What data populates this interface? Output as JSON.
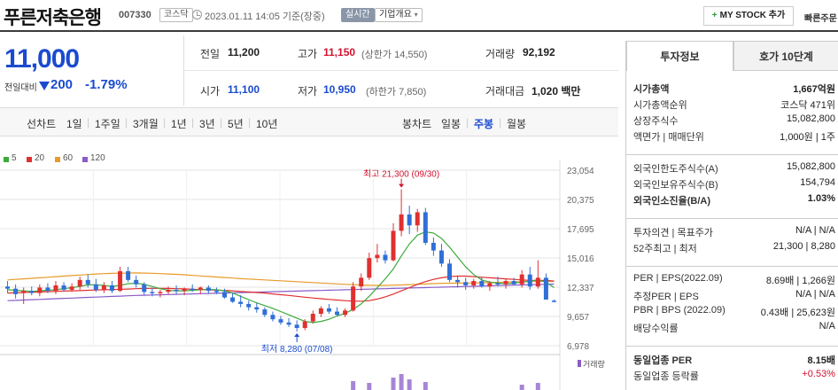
{
  "header": {
    "company_name": "푸른저축은행",
    "code": "007330",
    "market_badge": "코스닥",
    "datetime": "2023.01.11 14:05 기준(장중)",
    "realtime_badge": "실시간",
    "corp_overview": "기업개요",
    "my_stock_button": "MY STOCK 추가",
    "quick_link": "빠른주문"
  },
  "price": {
    "current": "11,000",
    "change_label": "전일대비",
    "change_value": "200",
    "change_pct": "-1.79%"
  },
  "summary": {
    "prev_close_label": "전일",
    "prev_close": "11,200",
    "high_label": "고가",
    "high": "11,150",
    "upper_limit": "(상한가 14,550)",
    "volume_label": "거래량",
    "volume": "92,192",
    "open_label": "시가",
    "open": "11,100",
    "low_label": "저가",
    "low": "10,950",
    "lower_limit": "(하한가 7,850)",
    "amount_label": "거래대금",
    "amount": "1,020 백만"
  },
  "period_bar": {
    "line_chart_label": "선차트",
    "line_periods": [
      "1일",
      "1주일",
      "3개월",
      "1년",
      "3년",
      "5년",
      "10년"
    ],
    "candle_label": "봉차트",
    "candle_periods": [
      "일봉",
      "주봉",
      "월봉"
    ],
    "active_candle": "주봉"
  },
  "chart": {
    "legend": [
      {
        "label": "5",
        "color": "#3caa3c"
      },
      {
        "label": "20",
        "color": "#e03030"
      },
      {
        "label": "60",
        "color": "#e89a2a"
      },
      {
        "label": "120",
        "color": "#8a5cc8"
      }
    ],
    "high_annotation": "최고 21,300 (09/30)",
    "low_annotation": "최저 8,280 (07/08)",
    "y_ticks": [
      "23,054",
      "20,375",
      "17,695",
      "15,016",
      "12,337",
      "9,657",
      "6,978"
    ],
    "volume_label": "거래량",
    "up_color": "#e03030",
    "down_color": "#2f6fd6"
  },
  "chart_data": {
    "type": "candlestick",
    "ylim": [
      6978,
      23054
    ],
    "y_ticks": [
      23054,
      20375,
      17695,
      15016,
      12337,
      9657,
      6978
    ],
    "candles": [
      [
        12400,
        12900,
        11800,
        12200
      ],
      [
        12200,
        12600,
        11300,
        11700
      ],
      [
        11800,
        12300,
        10800,
        12000
      ],
      [
        12000,
        12400,
        11600,
        11800
      ],
      [
        11800,
        12600,
        11500,
        12300
      ],
      [
        12300,
        12700,
        11800,
        12000
      ],
      [
        12000,
        12900,
        11700,
        12500
      ],
      [
        12500,
        12800,
        12000,
        12100
      ],
      [
        12100,
        12700,
        11900,
        12400
      ],
      [
        12400,
        13300,
        12100,
        13000
      ],
      [
        13000,
        13500,
        12300,
        12600
      ],
      [
        12600,
        13100,
        11900,
        12100
      ],
      [
        12100,
        12800,
        11800,
        12500
      ],
      [
        12500,
        12900,
        11800,
        12000
      ],
      [
        12000,
        14200,
        11900,
        13800
      ],
      [
        13800,
        14200,
        12800,
        13000
      ],
      [
        13000,
        13400,
        12300,
        12600
      ],
      [
        12600,
        12800,
        11600,
        11900
      ],
      [
        11900,
        12300,
        11500,
        11800
      ],
      [
        11800,
        12100,
        11400,
        11900
      ],
      [
        11900,
        12400,
        11700,
        12100
      ],
      [
        12100,
        12500,
        11700,
        12000
      ],
      [
        12000,
        12300,
        11600,
        12200
      ],
      [
        12200,
        12600,
        11900,
        12100
      ],
      [
        12100,
        12400,
        11700,
        12300
      ],
      [
        12300,
        12500,
        11800,
        12000
      ],
      [
        12000,
        12300,
        11700,
        11900
      ],
      [
        11900,
        12200,
        11300,
        11400
      ],
      [
        11400,
        11800,
        10900,
        11000
      ],
      [
        11000,
        11600,
        10500,
        10800
      ],
      [
        10800,
        11100,
        10200,
        10500
      ],
      [
        10500,
        10900,
        10000,
        10300
      ],
      [
        10300,
        10500,
        9600,
        9800
      ],
      [
        9800,
        10100,
        9200,
        9400
      ],
      [
        9400,
        9700,
        8900,
        9100
      ],
      [
        9100,
        9500,
        8700,
        8900
      ],
      [
        8900,
        9300,
        8280,
        8600
      ],
      [
        8600,
        9400,
        8400,
        9200
      ],
      [
        9200,
        10200,
        9000,
        9900
      ],
      [
        9900,
        10600,
        9600,
        10400
      ],
      [
        10400,
        10800,
        9900,
        10100
      ],
      [
        10100,
        10500,
        9700,
        9800
      ],
      [
        9800,
        10400,
        9600,
        10200
      ],
      [
        10200,
        12800,
        10100,
        12400
      ],
      [
        12400,
        13600,
        12000,
        13200
      ],
      [
        13200,
        15500,
        13000,
        15000
      ],
      [
        15000,
        16300,
        14600,
        15300
      ],
      [
        15300,
        15700,
        14500,
        14800
      ],
      [
        14800,
        18200,
        14700,
        17500
      ],
      [
        17500,
        21300,
        17000,
        19000
      ],
      [
        19000,
        19800,
        17200,
        18000
      ],
      [
        18000,
        19500,
        17400,
        19200
      ],
      [
        19200,
        19600,
        16200,
        16400
      ],
      [
        16400,
        16900,
        15200,
        15700
      ],
      [
        15700,
        16300,
        14200,
        14500
      ],
      [
        14500,
        14900,
        12800,
        13000
      ],
      [
        13000,
        13400,
        12300,
        12800
      ],
      [
        12800,
        13200,
        12100,
        12500
      ],
      [
        12500,
        13100,
        12200,
        12900
      ],
      [
        12900,
        13300,
        12300,
        12400
      ],
      [
        12400,
        12900,
        12000,
        12700
      ],
      [
        12700,
        13300,
        12400,
        12600
      ],
      [
        12600,
        13100,
        12200,
        12900
      ],
      [
        12900,
        13200,
        12500,
        12600
      ],
      [
        12600,
        13900,
        12300,
        13500
      ],
      [
        13500,
        14200,
        12100,
        12400
      ],
      [
        12400,
        14800,
        12200,
        13200
      ],
      [
        13200,
        13600,
        11400,
        11200
      ],
      [
        11100,
        11200,
        10950,
        11000
      ]
    ],
    "ma5": [
      12100,
      12050,
      12000,
      11950,
      12000,
      12050,
      12100,
      12200,
      12300,
      12400,
      12550,
      12550,
      12500,
      12400,
      12500,
      12650,
      12700,
      12600,
      12400,
      12200,
      12050,
      12000,
      12000,
      12050,
      12100,
      12150,
      12100,
      12000,
      11800,
      11500,
      11200,
      10900,
      10650,
      10400,
      10100,
      9800,
      9500,
      9200,
      9100,
      9200,
      9400,
      9700,
      9950,
      10300,
      10800,
      11500,
      12300,
      13100,
      14000,
      15200,
      16300,
      17100,
      17400,
      17300,
      16800,
      16000,
      15100,
      14200,
      13500,
      13000,
      12800,
      12700,
      12650,
      12700,
      12800,
      12900,
      13000,
      12800,
      12300
    ],
    "ma20": [
      11800,
      11820,
      11850,
      11870,
      11900,
      11920,
      11950,
      11980,
      12000,
      12020,
      12050,
      12080,
      12100,
      12120,
      12150,
      12170,
      12200,
      12220,
      12230,
      12230,
      12220,
      12200,
      12180,
      12150,
      12120,
      12100,
      12070,
      12040,
      12000,
      11950,
      11900,
      11850,
      11800,
      11720,
      11650,
      11580,
      11500,
      11420,
      11350,
      11280,
      11220,
      11160,
      11100,
      11050,
      11050,
      11100,
      11250,
      11450,
      11700,
      12000,
      12300,
      12600,
      12850,
      13050,
      13200,
      13300,
      13350,
      13350,
      13300,
      13250,
      13200,
      13150,
      13100,
      13050,
      13000,
      12950,
      12950,
      12950,
      12900
    ],
    "ma60": [
      13000,
      13050,
      13100,
      13150,
      13200,
      13250,
      13300,
      13350,
      13400,
      13450,
      13500,
      13550,
      13580,
      13600,
      13620,
      13630,
      13640,
      13630,
      13610,
      13580,
      13550,
      13510,
      13470,
      13420,
      13370,
      13320,
      13270,
      13220,
      13170,
      13120,
      13080,
      13040,
      13000,
      12960,
      12920,
      12880,
      12840,
      12800,
      12760,
      12720,
      12680,
      12640,
      12600,
      12560,
      12530,
      12510,
      12500,
      12500,
      12520,
      12540,
      12570,
      12600,
      12630,
      12660,
      12690,
      12700,
      12710,
      12720,
      12730,
      12740,
      12760,
      12780,
      12800,
      12820,
      12840,
      12860,
      12870,
      12870,
      12870
    ],
    "ma120": [
      11100,
      11130,
      11160,
      11190,
      11220,
      11250,
      11280,
      11310,
      11340,
      11370,
      11400,
      11430,
      11460,
      11490,
      11520,
      11550,
      11580,
      11600,
      11620,
      11640,
      11660,
      11680,
      11700,
      11720,
      11740,
      11760,
      11780,
      11800,
      11820,
      11840,
      11860,
      11880,
      11900,
      11920,
      11940,
      11960,
      11980,
      12000,
      12020,
      12040,
      12060,
      12080,
      12100,
      12120,
      12140,
      12160,
      12180,
      12200,
      12220,
      12240,
      12260,
      12280,
      12300,
      12320,
      12340,
      12360,
      12380,
      12400,
      12420,
      12440,
      12460,
      12480,
      12500,
      12520,
      12540,
      12560,
      12580,
      12600,
      12620
    ],
    "volume": [
      0,
      0,
      0,
      0,
      0,
      0,
      0,
      0,
      0,
      0,
      0,
      0,
      0,
      0,
      0,
      0,
      0,
      0,
      0,
      0,
      0,
      0,
      0,
      0,
      0,
      0,
      0,
      0,
      0,
      0,
      0,
      0,
      0,
      0,
      0,
      0,
      0,
      0,
      0,
      0,
      0,
      0,
      0,
      0,
      0,
      0,
      0,
      0,
      0,
      0,
      0,
      0,
      0,
      0,
      0,
      0,
      0,
      0,
      0,
      0,
      0,
      0,
      0,
      0,
      0,
      0,
      0,
      0,
      0
    ],
    "series_names": [
      "5",
      "20",
      "60",
      "120"
    ],
    "high": {
      "value": 21300,
      "date": "09/30"
    },
    "low": {
      "value": 8280,
      "date": "07/08"
    }
  },
  "right_panel": {
    "tabs": [
      "투자정보",
      "호가 10단계"
    ],
    "rows1": [
      {
        "k": "시가총액",
        "v": "1,667억원",
        "bold": true
      },
      {
        "k": "시가총액순위",
        "v": "코스닥 471위"
      },
      {
        "k": "상장주식수",
        "v": "15,082,800"
      },
      {
        "k": "액면가 | 매매단위",
        "v": "1,000원 | 1주"
      }
    ],
    "rows2": [
      {
        "k": "외국인한도주식수(A)",
        "v": "15,082,800"
      },
      {
        "k": "외국인보유주식수(B)",
        "v": "154,794"
      },
      {
        "k": "외국인소진율(B/A)",
        "v": "1.03%",
        "bold": true
      }
    ],
    "rows3": [
      {
        "k": "투자의견 | 목표주가",
        "v": "N/A | N/A"
      },
      {
        "k": "52주최고 | 최저",
        "v": "21,300 | 8,280"
      }
    ],
    "rows4": [
      {
        "k": "PER | EPS(2022.09)",
        "v": "8.69배 | 1,266원"
      },
      {
        "k": "추정PER | EPS",
        "v": "N/A | N/A"
      },
      {
        "k": "PBR | BPS (2022.09)",
        "v": "0.43배 | 25,623원"
      },
      {
        "k": "배당수익률",
        "v": "N/A"
      }
    ],
    "rows5": [
      {
        "k": "동일업종 PER",
        "v": "8.15배",
        "bold": true
      },
      {
        "k": "동일업종 등락률",
        "v": "+0.53%",
        "red": true
      }
    ]
  }
}
